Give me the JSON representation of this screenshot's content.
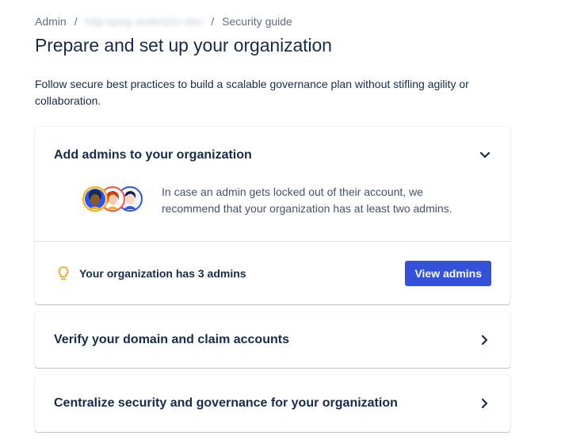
{
  "breadcrumb": {
    "items": [
      "Admin",
      "http-sprig-anderson-dev",
      "Security guide"
    ],
    "separator": "/"
  },
  "page": {
    "title": "Prepare and set up your organization",
    "intro": "Follow secure best practices to build a scalable governance plan without stifling agility or collaboration."
  },
  "cards": [
    {
      "title": "Add admins to your organization",
      "expanded": true,
      "description": "In case an admin gets locked out of their account, we recommend that your organization has at least two admins.",
      "status_text": "Your organization has 3 admins",
      "action_label": "View admins"
    },
    {
      "title": "Verify your domain and claim accounts",
      "expanded": false
    },
    {
      "title": "Centralize security and governance for your organization",
      "expanded": false
    }
  ],
  "icons": {
    "expanded": "chevron-down-icon",
    "collapsed": "chevron-right-icon",
    "tip": "lightbulb-icon"
  },
  "colors": {
    "primary_button": "#3352d8",
    "text": "#172b4d",
    "subtle_text": "#5e6c84",
    "bulb": "#f5a623"
  }
}
